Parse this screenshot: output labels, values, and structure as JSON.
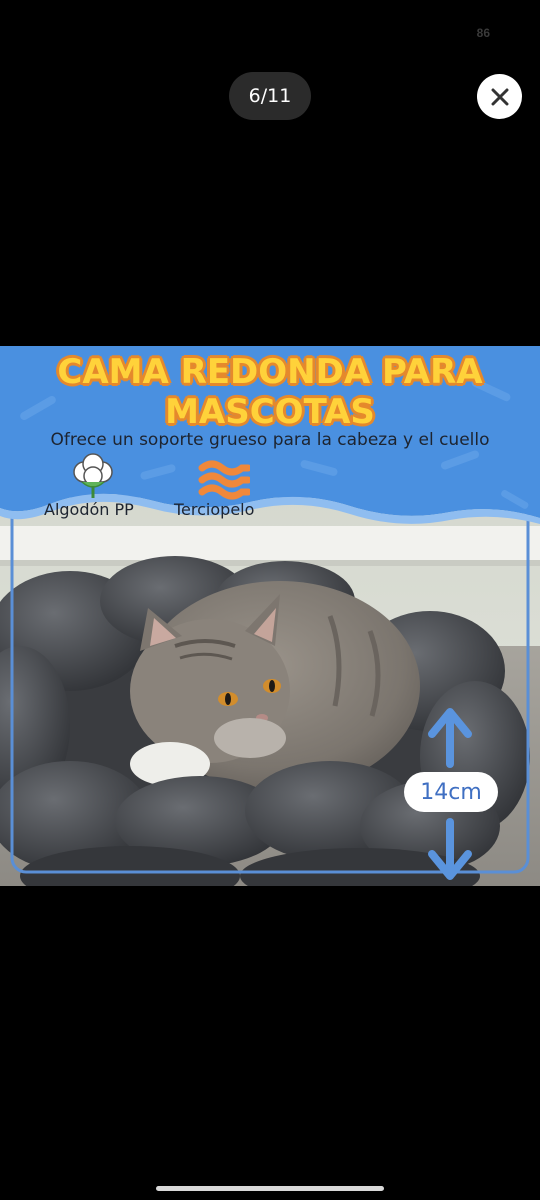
{
  "status": {
    "number": "86"
  },
  "viewer": {
    "counter": "6/11",
    "close_icon": "close-icon"
  },
  "slide": {
    "title_line1": "CAMA REDONDA PARA",
    "title_line2": "MASCOTAS",
    "subtitle": "Ofrece un soporte grueso para la cabeza y el cuello",
    "features": [
      {
        "label": "Algodón PP",
        "icon": "cotton-icon"
      },
      {
        "label": "Terciopelo",
        "icon": "velvet-icon"
      }
    ],
    "dimension": "14cm",
    "colors": {
      "banner": "#4a90e0",
      "title_fill": "#ffd23a",
      "title_outline": "#e5892c",
      "arrow": "#5a94de"
    }
  }
}
